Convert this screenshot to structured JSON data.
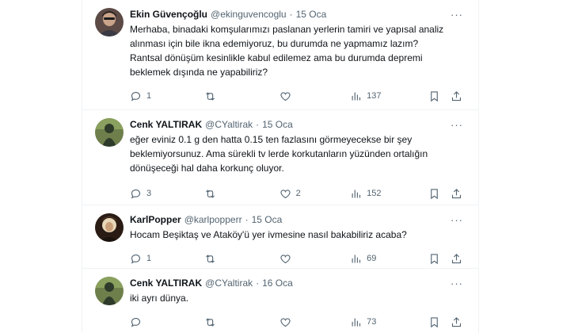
{
  "colors": {
    "text": "#0f1419",
    "secondary": "#536471",
    "divider": "#eff3f4"
  },
  "icons": {
    "reply": "reply-icon",
    "retweet": "retweet-icon",
    "like": "heart-icon",
    "views": "views-chart-icon",
    "bookmark": "bookmark-icon",
    "share": "share-icon",
    "more": "more-icon"
  },
  "tweets": [
    {
      "name": "Ekin Güvençoğlu",
      "handle": "@ekinguvencoglu",
      "sep": "·",
      "date": "15 Oca",
      "more": "···",
      "text": "Merhaba, binadaki komşularımızı paslanan yerlerin tamiri ve yapısal analiz\nalınması için bile ikna edemiyoruz, bu durumda ne yapmamız lazım?\nRantsal dönüşüm kesinlikle kabul edilemez ama bu durumda depremi\nbeklemek dışında ne yapabiliriz?",
      "replies": "1",
      "retweets": "",
      "likes": "",
      "views": "137"
    },
    {
      "name": "Cenk YALTIRAK",
      "handle": "@CYaltirak",
      "sep": "·",
      "date": "15 Oca",
      "more": "···",
      "text": "eğer eviniz 0.1 g den hatta 0.15 ten fazlasını görmeyecekse bir şey\nbeklemiyorsunuz.  Ama sürekli tv lerde korkutanların yüzünden ortalığın\ndönüşeceği hal daha korkunç oluyor.",
      "replies": "3",
      "retweets": "",
      "likes": "2",
      "views": "152"
    },
    {
      "name": "KarlPopper",
      "handle": "@karlpopperr",
      "sep": "·",
      "date": "15 Oca",
      "more": "···",
      "text": "Hocam Beşiktaş ve Ataköy'ü yer ivmesine nasıl bakabiliriz acaba?",
      "replies": "1",
      "retweets": "",
      "likes": "",
      "views": "69"
    },
    {
      "name": "Cenk YALTIRAK",
      "handle": "@CYaltirak",
      "sep": "·",
      "date": "16 Oca",
      "more": "···",
      "text": "iki ayrı dünya.",
      "replies": "",
      "retweets": "",
      "likes": "",
      "views": "73"
    }
  ]
}
